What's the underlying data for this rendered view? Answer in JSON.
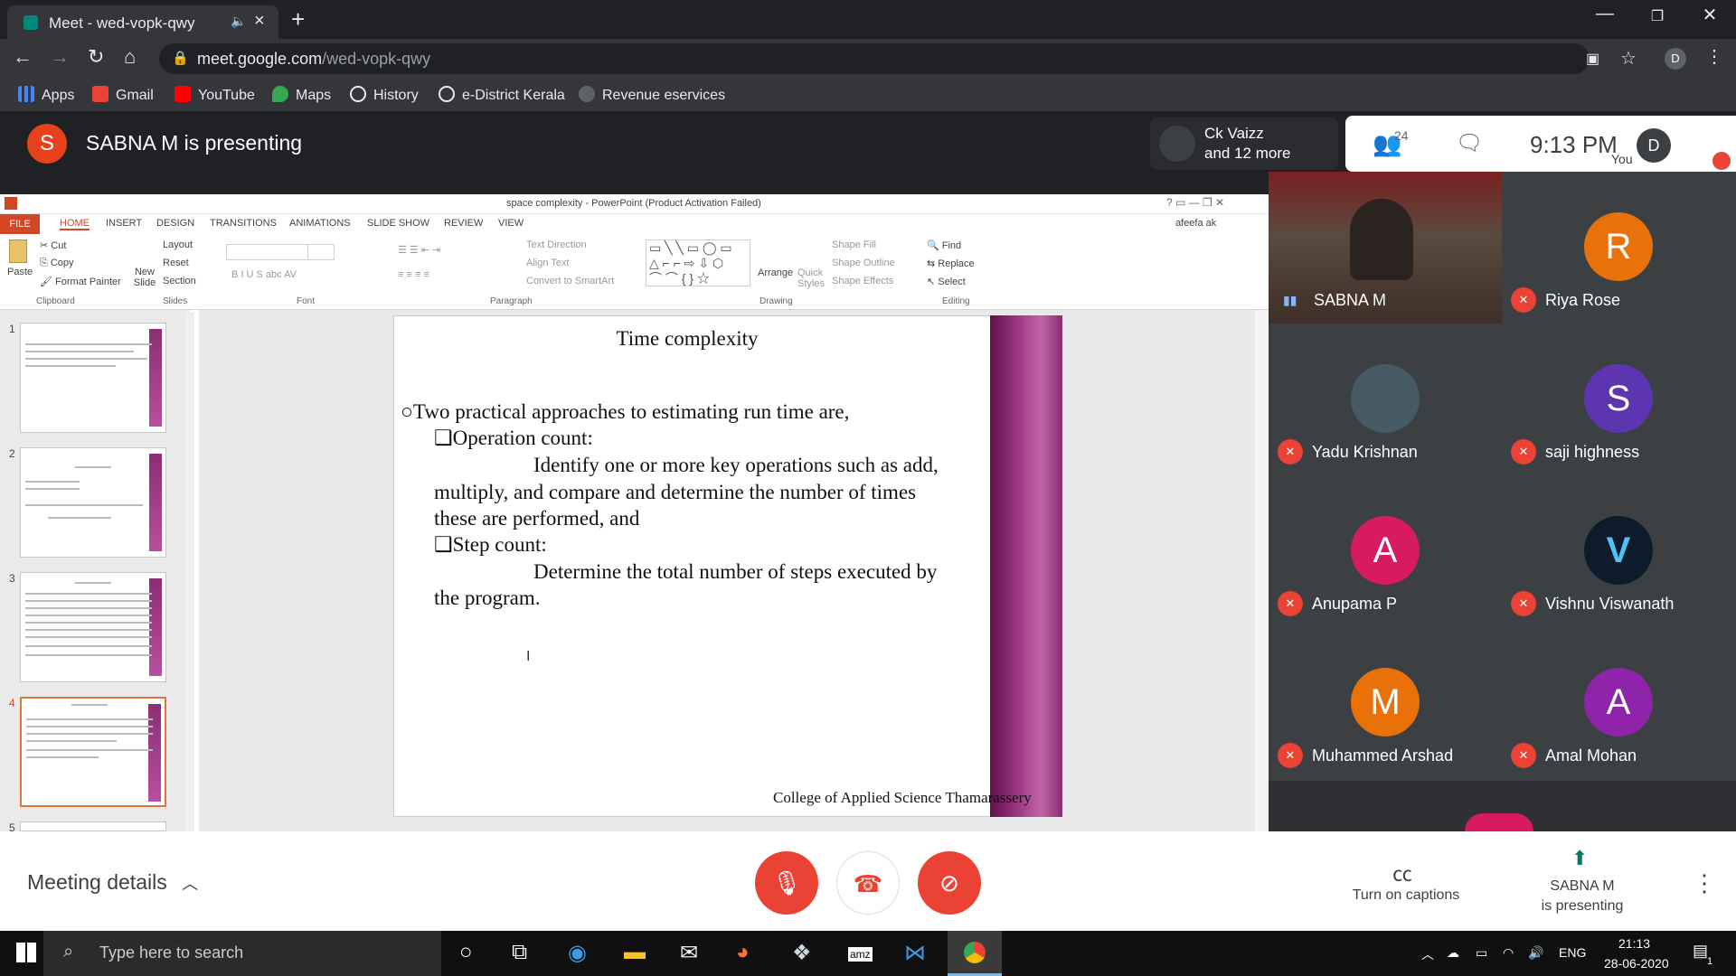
{
  "browser": {
    "tab_title": "Meet - wed-vopk-qwy",
    "url_host": "meet.google.com",
    "url_path": "/wed-vopk-qwy",
    "bookmarks": [
      "Apps",
      "Gmail",
      "YouTube",
      "Maps",
      "History",
      "e-District Kerala",
      "Revenue eservices"
    ],
    "profile_initial": "D"
  },
  "meet": {
    "presenter_initial": "S",
    "presenting_title": "SABNA M is presenting",
    "others_line1": "Ck Vaizz",
    "others_line2": "and 12 more",
    "people_count": "24",
    "clock": "9:13 PM",
    "you_label": "You",
    "you_initial": "D",
    "meeting_details": "Meeting details",
    "captions_label": "Turn on captions",
    "presenting_btn_line1": "SABNA M",
    "presenting_btn_line2": "is presenting"
  },
  "participants": [
    {
      "name": "SABNA M",
      "initial": "",
      "color": "#6d4c41"
    },
    {
      "name": "Riya Rose",
      "initial": "R",
      "color": "#e8710a"
    },
    {
      "name": "Yadu Krishnan",
      "initial": "",
      "color": "#455a64"
    },
    {
      "name": "saji highness",
      "initial": "S",
      "color": "#5e35b1"
    },
    {
      "name": "Anupama P",
      "initial": "A",
      "color": "#d81b60"
    },
    {
      "name": "Vishnu Viswanath",
      "initial": "V",
      "color": "#0d1b2a"
    },
    {
      "name": "Muhammed Arshad",
      "initial": "M",
      "color": "#e8710a"
    },
    {
      "name": "Amal Mohan",
      "initial": "A",
      "color": "#8e24aa"
    }
  ],
  "powerpoint": {
    "window_title": "space complexity - PowerPoint (Product Activation Failed)",
    "file_tab": "FILE",
    "tabs": [
      "HOME",
      "INSERT",
      "DESIGN",
      "TRANSITIONS",
      "ANIMATIONS",
      "SLIDE SHOW",
      "REVIEW",
      "VIEW"
    ],
    "user": "afeefa ak",
    "clipboard": {
      "paste": "Paste",
      "cut": "Cut",
      "copy": "Copy",
      "format_painter": "Format Painter",
      "group": "Clipboard"
    },
    "slides": {
      "new_slide": "New Slide",
      "layout": "Layout",
      "reset": "Reset",
      "section": "Section",
      "group": "Slides"
    },
    "groups": {
      "font": "Font",
      "paragraph": "Paragraph",
      "drawing": "Drawing",
      "editing": "Editing"
    },
    "paragraph": {
      "text_direction": "Text Direction",
      "align_text": "Align Text",
      "convert": "Convert to SmartArt"
    },
    "drawing": {
      "arrange": "Arrange",
      "quick_styles": "Quick Styles",
      "shape_fill": "Shape Fill",
      "shape_outline": "Shape Outline",
      "shape_effects": "Shape Effects"
    },
    "editing": {
      "find": "Find",
      "replace": "Replace",
      "select": "Select"
    },
    "thumb_numbers": [
      "1",
      "2",
      "3",
      "4",
      "5"
    ],
    "slide": {
      "title": "Time complexity",
      "bullet": "Two practical approaches to estimating run time are,",
      "sub1_head": "Operation count:",
      "sub1_l1": "Identify one or more key operations such as add,",
      "sub1_l2": "multiply, and compare and determine the number of times",
      "sub1_l3": "these are performed, and",
      "sub2_head": "Step count:",
      "sub2_l1": "Determine the total number of steps executed by",
      "sub2_l2": "the program.",
      "footer": "College of Applied Science Thamarassery"
    }
  },
  "taskbar": {
    "search_placeholder": "Type here to search",
    "lang": "ENG",
    "time": "21:13",
    "date": "28-06-2020",
    "notif_count": "1"
  }
}
